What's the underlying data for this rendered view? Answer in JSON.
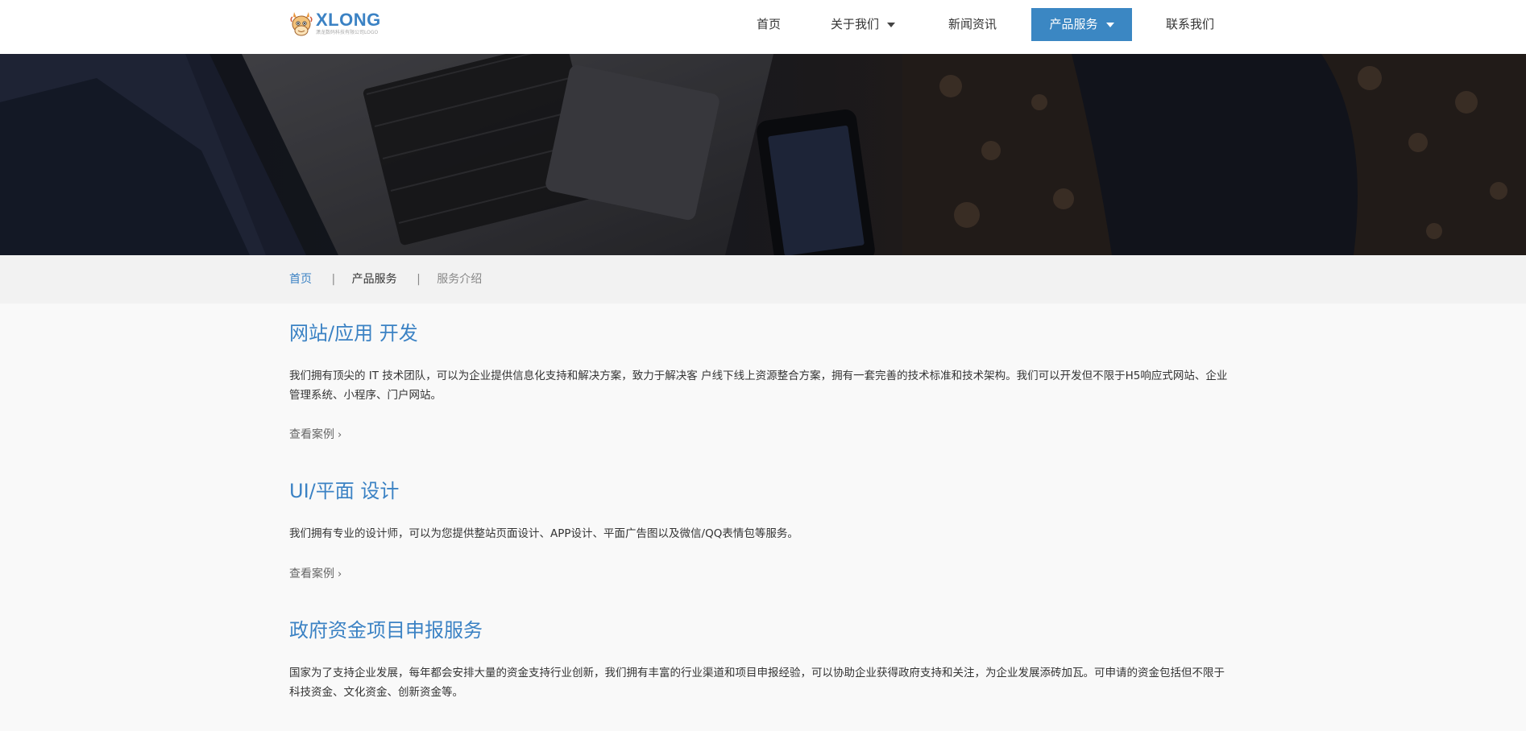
{
  "logo": {
    "title": "XLONG",
    "subtitle": "潇龙数码科技有限公司LOGO",
    "icon": "dragon-mascot-icon"
  },
  "nav": {
    "items": [
      {
        "label": "首页",
        "dropdown": false,
        "active": false
      },
      {
        "label": "关于我们",
        "dropdown": true,
        "active": false
      },
      {
        "label": "新闻资讯",
        "dropdown": false,
        "active": false
      },
      {
        "label": "产品服务",
        "dropdown": true,
        "active": true
      },
      {
        "label": "联系我们",
        "dropdown": false,
        "active": false
      }
    ]
  },
  "hero": {
    "image": "laptop-keyboard-and-phone-banner"
  },
  "breadcrumb": {
    "home": "首页",
    "sep": "|",
    "category": "产品服务",
    "current": "服务介绍"
  },
  "sections": [
    {
      "title": "网站/应用 开发",
      "description": "我们拥有顶尖的 IT 技术团队，可以为企业提供信息化支持和解决方案，致力于解决客 户线下线上资源整合方案，拥有一套完善的技术标准和技术架构。我们可以开发但不限于H5响应式网站、企业管理系统、小程序、门户网站。",
      "link": "查看案例"
    },
    {
      "title": "UI/平面 设计",
      "description": "我们拥有专业的设计师，可以为您提供整站页面设计、APP设计、平面广告图以及微信/QQ表情包等服务。",
      "link": "查看案例"
    },
    {
      "title": "政府资金项目申报服务",
      "description": "国家为了支持企业发展，每年都会安排大量的资金支持行业创新，我们拥有丰富的行业渠道和项目申报经验，可以协助企业获得政府支持和关注，为企业发展添砖加瓦。可申请的资金包括但不限于科技资金、文化资金、创新资金等。",
      "link": ""
    }
  ],
  "colors": {
    "accent": "#3b87c3",
    "title": "#3b82c4",
    "background": "#f9f9f9"
  }
}
